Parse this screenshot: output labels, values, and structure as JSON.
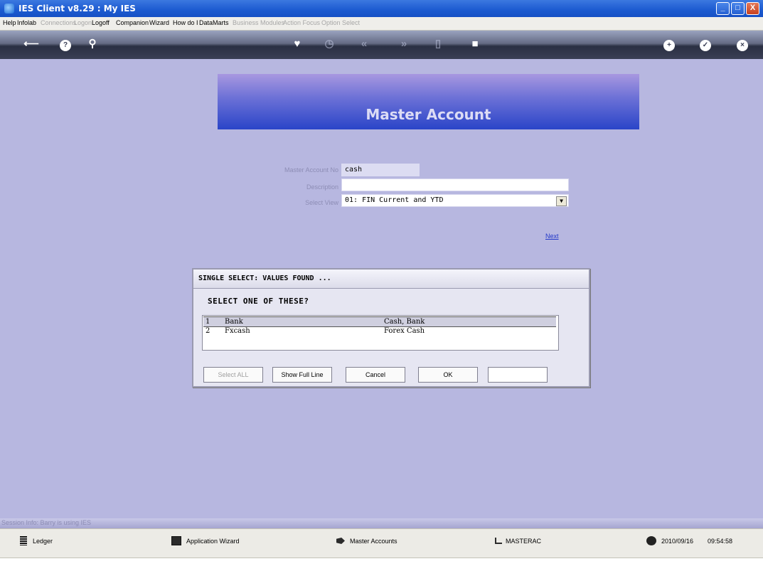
{
  "window": {
    "title": "IES Client v8.29 : My IES",
    "min": "_",
    "max": "□",
    "close": "X"
  },
  "menu": [
    {
      "label": "Help",
      "enabled": true
    },
    {
      "label": "Infolab",
      "enabled": true
    },
    {
      "label": "Connections",
      "enabled": false
    },
    {
      "label": "Logon",
      "enabled": false
    },
    {
      "label": "Logoff",
      "enabled": true
    },
    {
      "label": "Companion",
      "enabled": true
    },
    {
      "label": "Wizard",
      "enabled": true
    },
    {
      "label": "How do I",
      "enabled": true
    },
    {
      "label": "DataMarts",
      "enabled": true
    },
    {
      "label": "Business Modules",
      "enabled": false
    },
    {
      "label": "Action Focus",
      "enabled": false
    },
    {
      "label": "Option Select",
      "enabled": false
    }
  ],
  "toolbar": {
    "back": "⟵",
    "help": "?",
    "search": "⚲",
    "favorite": "♥",
    "history": "◷",
    "first": "«",
    "last": "»",
    "page": "▯",
    "stop": "■",
    "add": "+",
    "confirm": "✓",
    "close": "×"
  },
  "page": {
    "title": "Master Account"
  },
  "form": {
    "account_label": "Master Account No",
    "account_value": "cash",
    "description_label": "Description",
    "description_value": "",
    "view_label": "Select View",
    "view_value": "01: FIN Current and YTD",
    "dropdown_arrow": "▼",
    "next_label": "Next"
  },
  "dialog": {
    "title": "SINGLE SELECT: VALUES FOUND ...",
    "prompt": "SELECT ONE OF THESE?",
    "rows": [
      {
        "num": "1",
        "code": "Bank",
        "desc": "Cash, Bank"
      },
      {
        "num": "2",
        "code": "Fxcash",
        "desc": "Forex Cash"
      }
    ],
    "buttons": {
      "select_all": "Select ALL",
      "show_full_line": "Show Full Line",
      "cancel": "Cancel",
      "ok": "OK"
    }
  },
  "session": {
    "info": "Session Info: Barry is using IES"
  },
  "status": {
    "ledger": "Ledger",
    "app_wizard": "Application Wizard",
    "master_accounts": "Master Accounts",
    "module": "MASTERAC",
    "date": "2010/09/16",
    "time": "09:54:58"
  }
}
